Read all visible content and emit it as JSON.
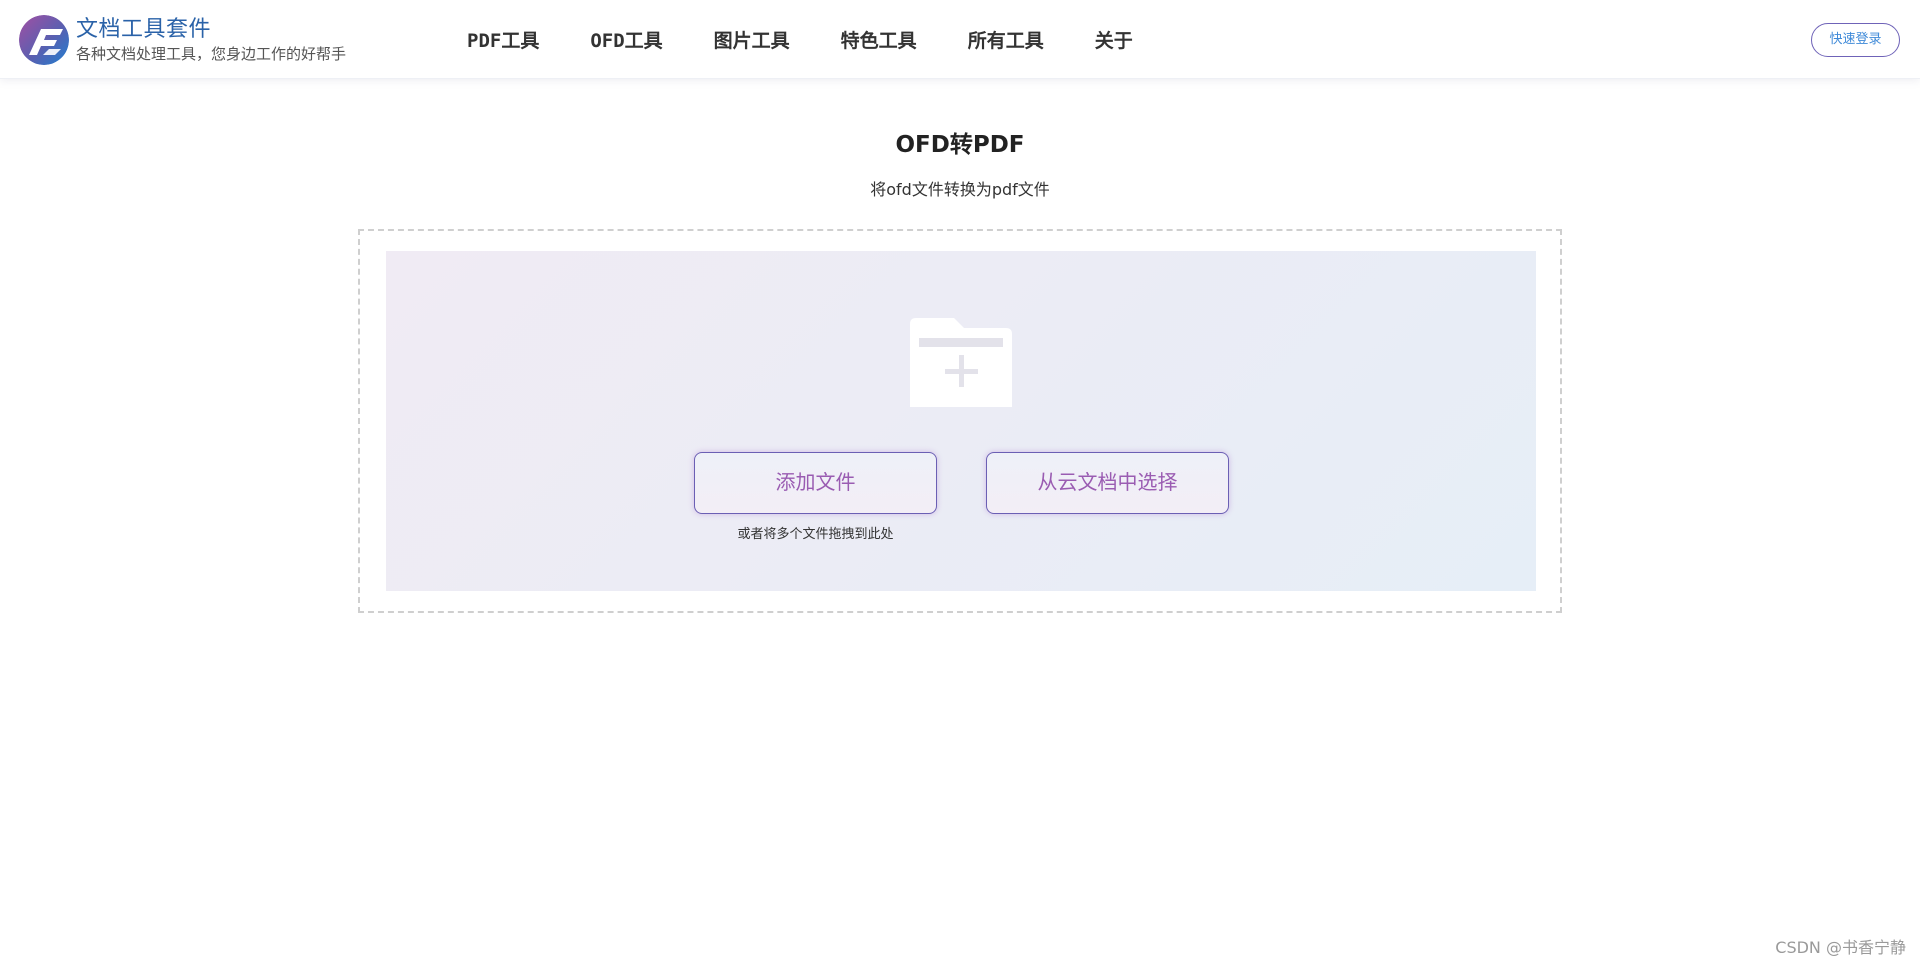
{
  "header": {
    "brand_title": "文档工具套件",
    "brand_subtitle": "各种文档处理工具，您身边工作的好帮手",
    "nav": [
      {
        "label": "PDF工具"
      },
      {
        "label": "OFD工具"
      },
      {
        "label": "图片工具"
      },
      {
        "label": "特色工具"
      },
      {
        "label": "所有工具"
      },
      {
        "label": "关于"
      }
    ],
    "login_label": "快速登录"
  },
  "main": {
    "title": "OFD转PDF",
    "subtitle": "将ofd文件转换为pdf文件",
    "upload": {
      "folder_icon": "folder-plus-icon",
      "add_file_label": "添加文件",
      "cloud_select_label": "从云文档中选择",
      "drop_hint": "或者将多个文件拖拽到此处"
    }
  },
  "watermark": "CSDN @书香宁静",
  "colors": {
    "brand_blue": "#2a62a8",
    "accent_purple": "#6b5fb4",
    "button_text": "#9a5cb2",
    "login_text": "#3f8ad8"
  }
}
